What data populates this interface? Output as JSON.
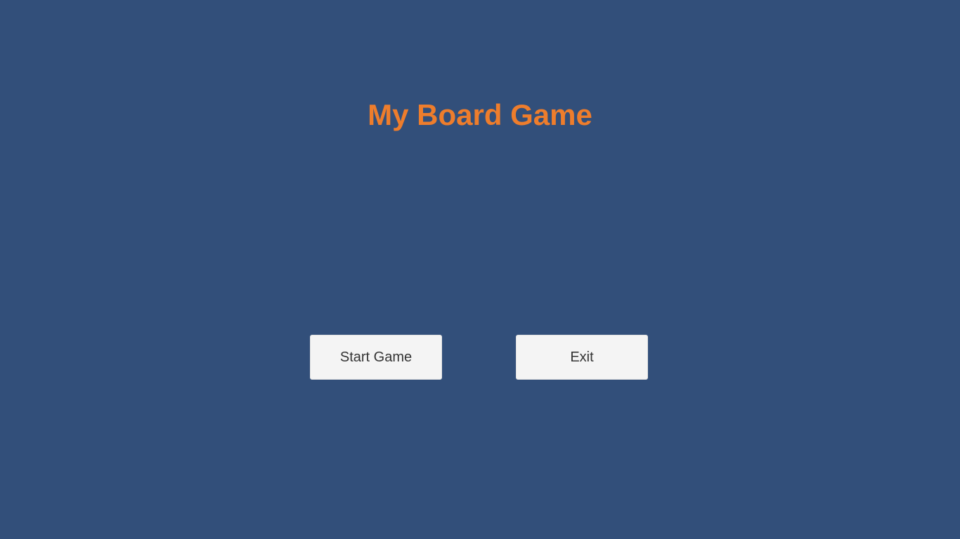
{
  "app": {
    "title": "My Board Game"
  },
  "menu": {
    "start_label": "Start Game",
    "exit_label": "Exit"
  },
  "colors": {
    "background": "#324f7a",
    "title": "#ee7d2c",
    "button_background": "#f4f4f4",
    "button_text": "#333333"
  }
}
